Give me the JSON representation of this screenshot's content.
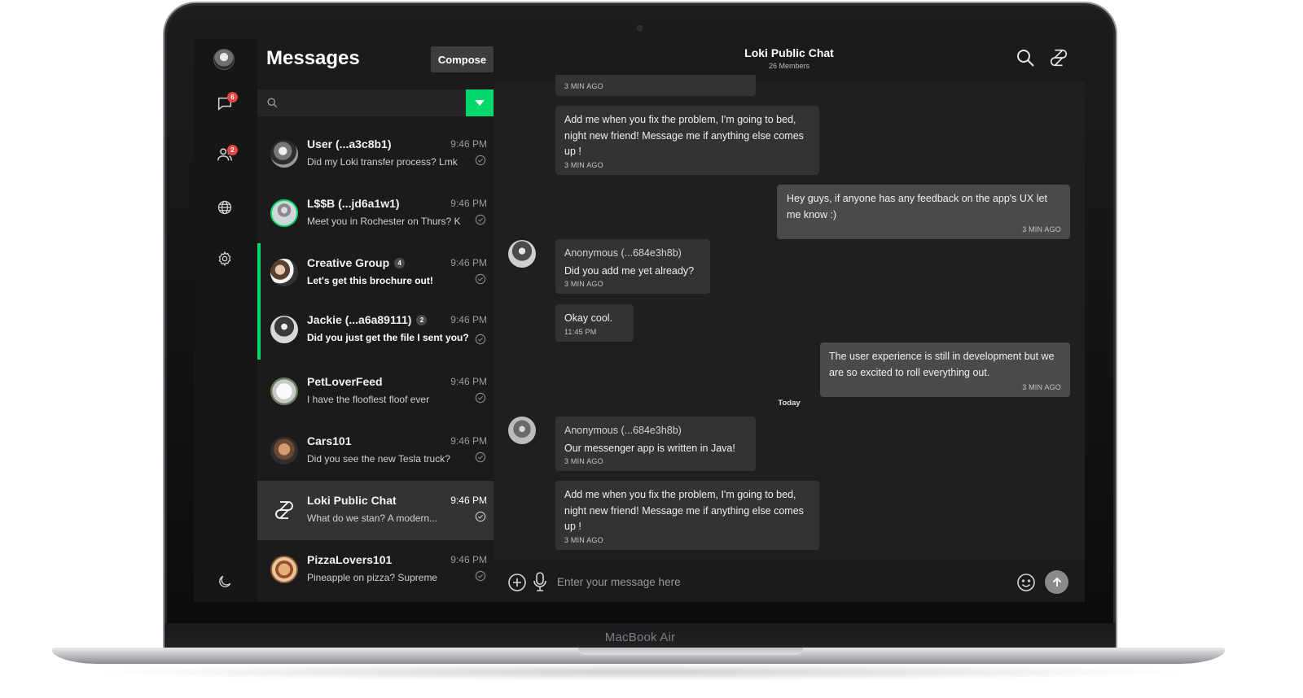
{
  "device": {
    "label": "MacBook Air"
  },
  "rail": {
    "chat_badge": "6",
    "contacts_badge": "2"
  },
  "list": {
    "title": "Messages",
    "compose_label": "Compose",
    "search_placeholder": "",
    "conversations": [
      {
        "name": "User (...a3c8b1)",
        "preview": "Did my Loki transfer process? Lmk",
        "time": "9:46 PM",
        "count": ""
      },
      {
        "name": "L$$B (...jd6a1w1)",
        "preview": "Meet you in Rochester on Thurs? K",
        "time": "9:46 PM",
        "count": ""
      },
      {
        "name": "Creative Group",
        "preview": "Let's get this brochure out!",
        "time": "9:46 PM",
        "count": "4"
      },
      {
        "name": "Jackie (...a6a89111)",
        "preview": "Did you just get the file I sent you?",
        "time": "9:46 PM",
        "count": "2"
      },
      {
        "name": "PetLoverFeed",
        "preview": "I have the flooflest floof ever",
        "time": "9:46 PM",
        "count": ""
      },
      {
        "name": "Cars101",
        "preview": "Did you see the new Tesla truck?",
        "time": "9:46 PM",
        "count": ""
      },
      {
        "name": "Loki Public Chat",
        "preview": "What do we stan? A modern...",
        "time": "9:46 PM",
        "count": ""
      },
      {
        "name": "PizzaLovers101",
        "preview": "Pineapple on pizza? Supreme",
        "time": "9:46 PM",
        "count": ""
      }
    ]
  },
  "chat": {
    "title": "Loki Public Chat",
    "subtitle": "26 Members",
    "day_separator": "Today",
    "composer_placeholder": "Enter your message here",
    "messages": [
      {
        "sender": "",
        "text": "",
        "meta": "3 MIN AGO"
      },
      {
        "sender": "",
        "text": "Add me when you fix the problem, I'm going to bed, night new friend! Message me if anything else comes up !",
        "meta": "3 MIN AGO"
      },
      {
        "sender": "",
        "text": "Hey guys, if anyone has any feedback on the app's UX let me know :)",
        "meta": "3 MIN AGO"
      },
      {
        "sender": "Anonymous (...684e3h8b)",
        "text": "Did you add me yet already?",
        "meta": "3 MIN AGO"
      },
      {
        "sender": "",
        "text": "Okay cool.",
        "meta": "11:45 PM"
      },
      {
        "sender": "",
        "text": "The user experience is still in development but we are so excited to roll everything out.",
        "meta": "3 MIN AGO"
      },
      {
        "sender": "Anonymous (...684e3h8b)",
        "text": "Our messenger app is written in  Java!",
        "meta": "3 MIN AGO"
      },
      {
        "sender": "",
        "text": "Add me when you fix the problem, I'm going to bed, night new friend! Message me if anything else comes up !",
        "meta": "3 MIN AGO"
      }
    ]
  },
  "colors": {
    "accent": "#00d96a",
    "badge": "#e84545",
    "background": "#1c1c1c"
  }
}
